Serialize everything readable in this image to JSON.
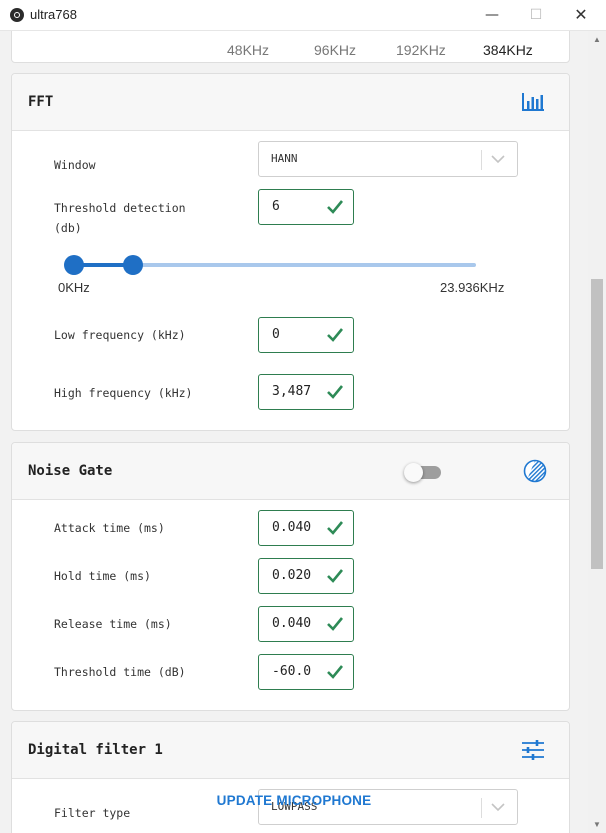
{
  "window": {
    "title": "ultra768",
    "minimize": "—",
    "maximize": "☐",
    "close": "✕"
  },
  "sample_rates": {
    "items": [
      "48KHz",
      "96KHz",
      "192KHz",
      "384KHz"
    ],
    "active": "384KHz"
  },
  "fft": {
    "title": "FFT",
    "icon": "bar-chart-icon",
    "window_label": "Window",
    "window_value": "HANN",
    "threshold_label_line1": "Threshold detection",
    "threshold_label_line2": "(db)",
    "threshold_value": "6",
    "slider": {
      "min_label": "0KHz",
      "max_label": "23.936KHz",
      "low_khz": 0,
      "high_khz": 3.487,
      "max_khz": 23.936
    },
    "low_freq_label": "Low frequency (kHz)",
    "low_freq_value": "0",
    "high_freq_label": "High frequency (kHz)",
    "high_freq_value": "3,487"
  },
  "noise_gate": {
    "title": "Noise Gate",
    "enabled": false,
    "icon": "contrast-circle-icon",
    "attack_label": "Attack time (ms)",
    "attack_value": "0.040",
    "hold_label": "Hold time (ms)",
    "hold_value": "0.020",
    "release_label": "Release time (ms)",
    "release_value": "0.040",
    "threshold_label": "Threshold time (dB)",
    "threshold_value": "-60.0"
  },
  "digital_filter": {
    "title": "Digital filter 1",
    "icon": "sliders-icon",
    "type_label": "Filter type",
    "type_value": "LOWPASS"
  },
  "actions": {
    "update_label": "UPDATE MICROPHONE"
  },
  "colors": {
    "accent_blue": "#1f6fc5",
    "valid_green": "#2e7d4f",
    "background": "#f2f2f2"
  }
}
